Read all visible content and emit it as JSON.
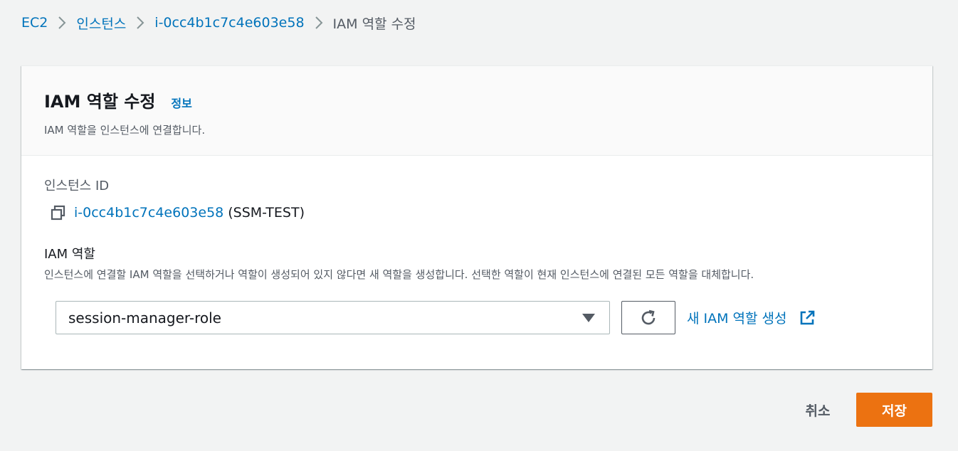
{
  "breadcrumb": {
    "items": [
      "EC2",
      "인스턴스",
      "i-0cc4b1c7c4e603e58"
    ],
    "current": "IAM 역할 수정"
  },
  "panel": {
    "title": "IAM 역할 수정",
    "info_link": "정보",
    "description": "IAM 역할을 인스턴스에 연결합니다."
  },
  "instance": {
    "label": "인스턴스 ID",
    "id": "i-0cc4b1c7c4e603e58",
    "name": "(SSM-TEST)",
    "copy_icon": "copy-icon"
  },
  "role": {
    "label": "IAM 역할",
    "description": "인스턴스에 연결할 IAM 역할을 선택하거나 역할이 생성되어 있지 않다면 새 역할을 생성합니다. 선택한 역할이 현재 인스턴스에 연결된 모든 역할을 대체합니다.",
    "selected": "session-manager-role",
    "refresh_icon": "refresh-icon",
    "create_link": "새 IAM 역할 생성",
    "external_icon": "external-link-icon"
  },
  "actions": {
    "cancel": "취소",
    "save": "저장"
  },
  "colors": {
    "link": "#0073bb",
    "primary": "#ec7211",
    "background": "#f2f3f3"
  }
}
